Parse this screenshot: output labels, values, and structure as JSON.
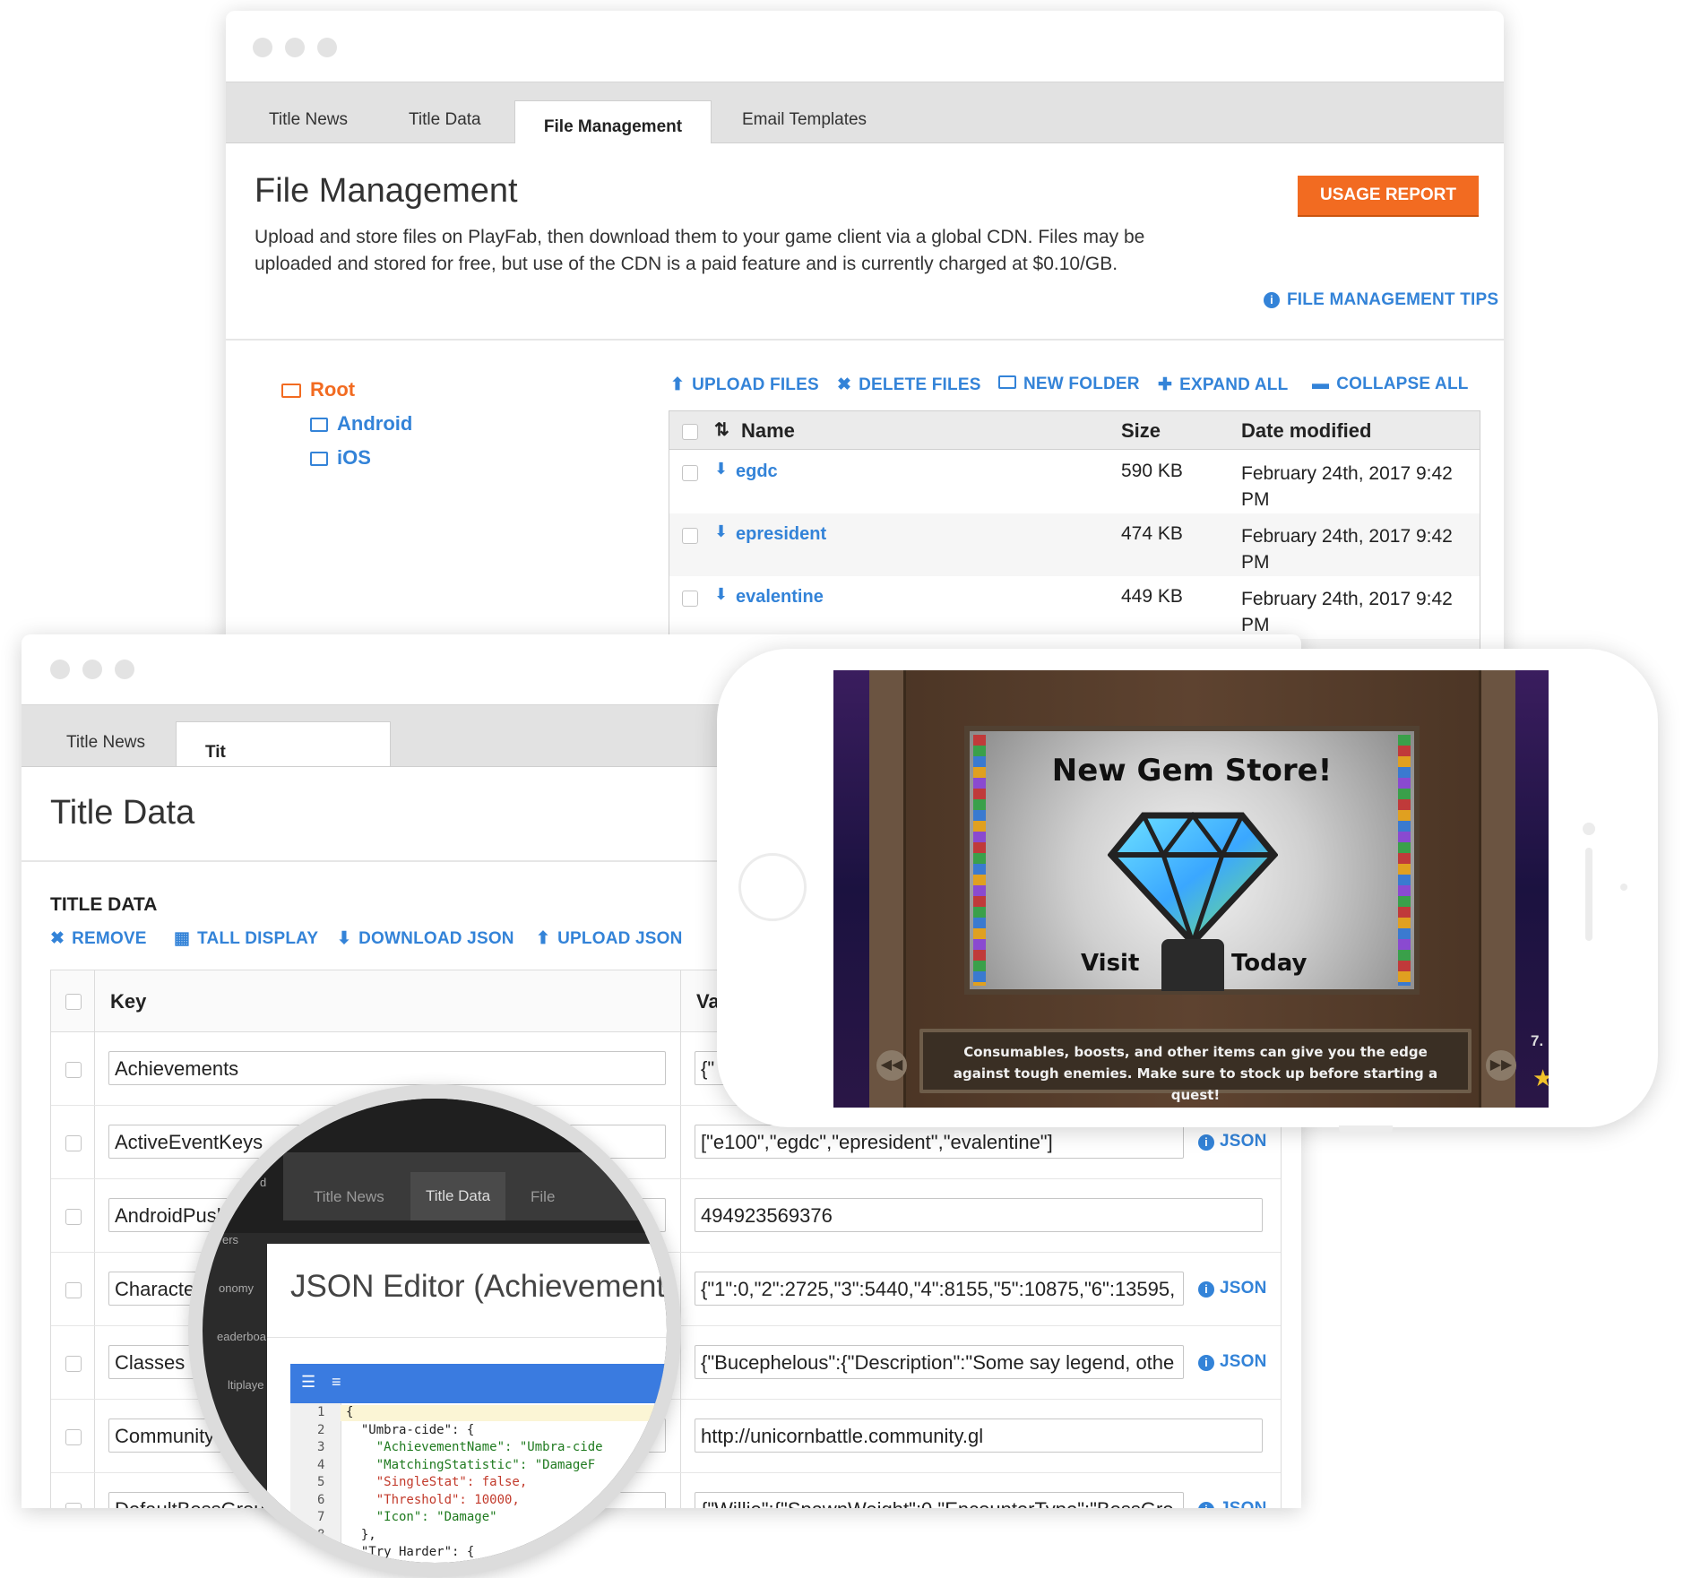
{
  "back_window": {
    "tabs": [
      "Title News",
      "Title Data",
      "File Management",
      "Email Templates"
    ],
    "active_tab": "File Management",
    "title": "File Management",
    "description": "Upload and store files on PlayFab, then download them to your game client via a global CDN. Files may be uploaded and stored for free, but use of the CDN is a paid feature and is currently charged at $0.10/GB.",
    "usage_report_label": "USAGE REPORT",
    "tips_label": "FILE MANAGEMENT TIPS",
    "tree": {
      "root": "Root",
      "children": [
        "Android",
        "iOS"
      ]
    },
    "actions": [
      "UPLOAD FILES",
      "DELETE FILES",
      "NEW FOLDER",
      "EXPAND ALL",
      "COLLAPSE ALL"
    ],
    "table": {
      "columns": [
        "Name",
        "Size",
        "Date modified"
      ],
      "rows": [
        {
          "name": "egdc",
          "size": "590 KB",
          "date": "February 24th, 2017 9:42 PM"
        },
        {
          "name": "epresident",
          "size": "474 KB",
          "date": "February 24th, 2017 9:42 PM"
        },
        {
          "name": "evalentine",
          "size": "449 KB",
          "date": "February 24th, 2017 9:42 PM"
        }
      ]
    }
  },
  "front_window": {
    "tabs": [
      "Title News",
      "Tit"
    ],
    "title": "Title Data",
    "section_title": "TITLE DATA",
    "actions": [
      "REMOVE",
      "TALL DISPLAY",
      "DOWNLOAD JSON",
      "UPLOAD JSON"
    ],
    "columns": [
      "Key",
      "Va"
    ],
    "rows": [
      {
        "key": "Achievements",
        "value": "{\"",
        "json": ""
      },
      {
        "key": "ActiveEventKeys",
        "value": "[\"e100\",\"egdc\",\"epresident\",\"evalentine\"]",
        "json": "JSON"
      },
      {
        "key": "AndroidPushS",
        "value": "494923569376",
        "json": ""
      },
      {
        "key": "CharacterL",
        "value": "{\"1\":0,\"2\":2725,\"3\":5440,\"4\":8155,\"5\":10875,\"6\":13595,",
        "json": "JSON"
      },
      {
        "key": "Classes",
        "value": "{\"Bucephelous\":{\"Description\":\"Some say legend, othe",
        "json": "JSON"
      },
      {
        "key": "CommunityW",
        "value": "http://unicornbattle.community.gl",
        "json": ""
      },
      {
        "key": "DefaultBossGroup",
        "value": "{\"Willie\":{\"SpawnWeight\":0,\"EncounterType\":\"BossGro",
        "json": "JSON"
      }
    ]
  },
  "magnifier": {
    "tabs": [
      "Title News",
      "Title Data",
      "File"
    ],
    "side_fragments": [
      "d",
      "ers",
      "onomy",
      "eaderboa",
      "ltiplaye"
    ],
    "editor_title": "JSON Editor (Achievements",
    "code_lines": [
      {
        "n": "1",
        "text": "{"
      },
      {
        "n": "2",
        "text": "  \"Umbra-cide\": {"
      },
      {
        "n": "3",
        "text": "    \"AchievementName\": \"Umbra-cide"
      },
      {
        "n": "4",
        "text": "    \"MatchingStatistic\": \"DamageF"
      },
      {
        "n": "5",
        "text": "    \"SingleStat\": false,"
      },
      {
        "n": "6",
        "text": "    \"Threshold\": 10000,"
      },
      {
        "n": "7",
        "text": "    \"Icon\": \"Damage\""
      },
      {
        "n": "8",
        "text": "  },"
      },
      {
        "n": "9",
        "text": "  \"Try Harder\": {"
      }
    ]
  },
  "phone": {
    "game_title": "New Gem Store!",
    "visit_label": "Visit",
    "today_label": "Today",
    "caption": "Consumables, boosts, and other items can give you the edge against tough enemies. Make sure to stock up before starting a quest!",
    "corner_number": "7."
  },
  "colors": {
    "accent_blue": "#3383d8",
    "usage_orange": "#f26b21",
    "root_orange": "#f26b21",
    "editor_blue": "#3a7be0"
  }
}
